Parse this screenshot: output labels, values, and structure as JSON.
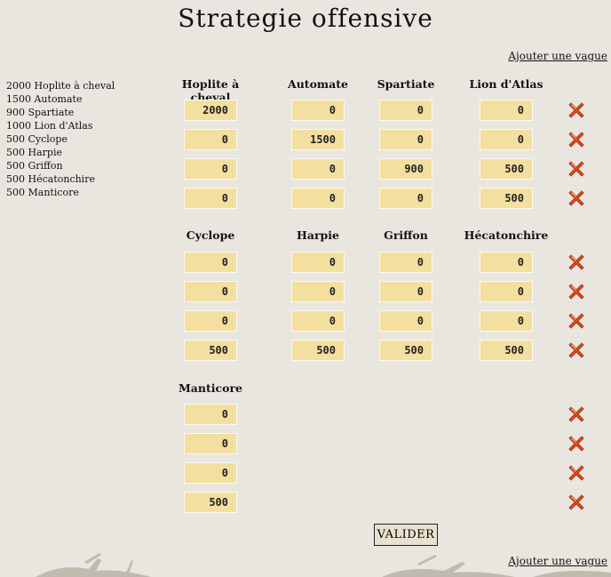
{
  "page": {
    "title": "Strategie offensive"
  },
  "links": {
    "add_wave_top": "Ajouter une vague",
    "add_wave_bottom": "Ajouter une vague"
  },
  "summary": [
    "2000 Hoplite à cheval",
    "1500 Automate",
    "900 Spartiate",
    "1000 Lion d'Atlas",
    "500 Cyclope",
    "500 Harpie",
    "500 Griffon",
    "500 Hécatonchire",
    "500 Manticore"
  ],
  "groups": [
    {
      "headers": [
        "Hoplite à cheval",
        "Automate",
        "Spartiate",
        "Lion d'Atlas"
      ],
      "rows": [
        [
          "2000",
          "0",
          "0",
          "0"
        ],
        [
          "0",
          "1500",
          "0",
          "0"
        ],
        [
          "0",
          "0",
          "900",
          "500"
        ],
        [
          "0",
          "0",
          "0",
          "500"
        ]
      ]
    },
    {
      "headers": [
        "Cyclope",
        "Harpie",
        "Griffon",
        "Hécatonchire"
      ],
      "rows": [
        [
          "0",
          "0",
          "0",
          "0"
        ],
        [
          "0",
          "0",
          "0",
          "0"
        ],
        [
          "0",
          "0",
          "0",
          "0"
        ],
        [
          "500",
          "500",
          "500",
          "500"
        ]
      ]
    },
    {
      "headers": [
        "Manticore"
      ],
      "rows": [
        [
          "0"
        ],
        [
          "0"
        ],
        [
          "0"
        ],
        [
          "500"
        ]
      ]
    }
  ],
  "actions": {
    "submit_label": "VALIDER"
  },
  "icons": {
    "delete": "close-x-icon"
  },
  "colors": {
    "delete": "#e24a1d",
    "field": "#f3dfa0",
    "background": "#e9e6df"
  }
}
